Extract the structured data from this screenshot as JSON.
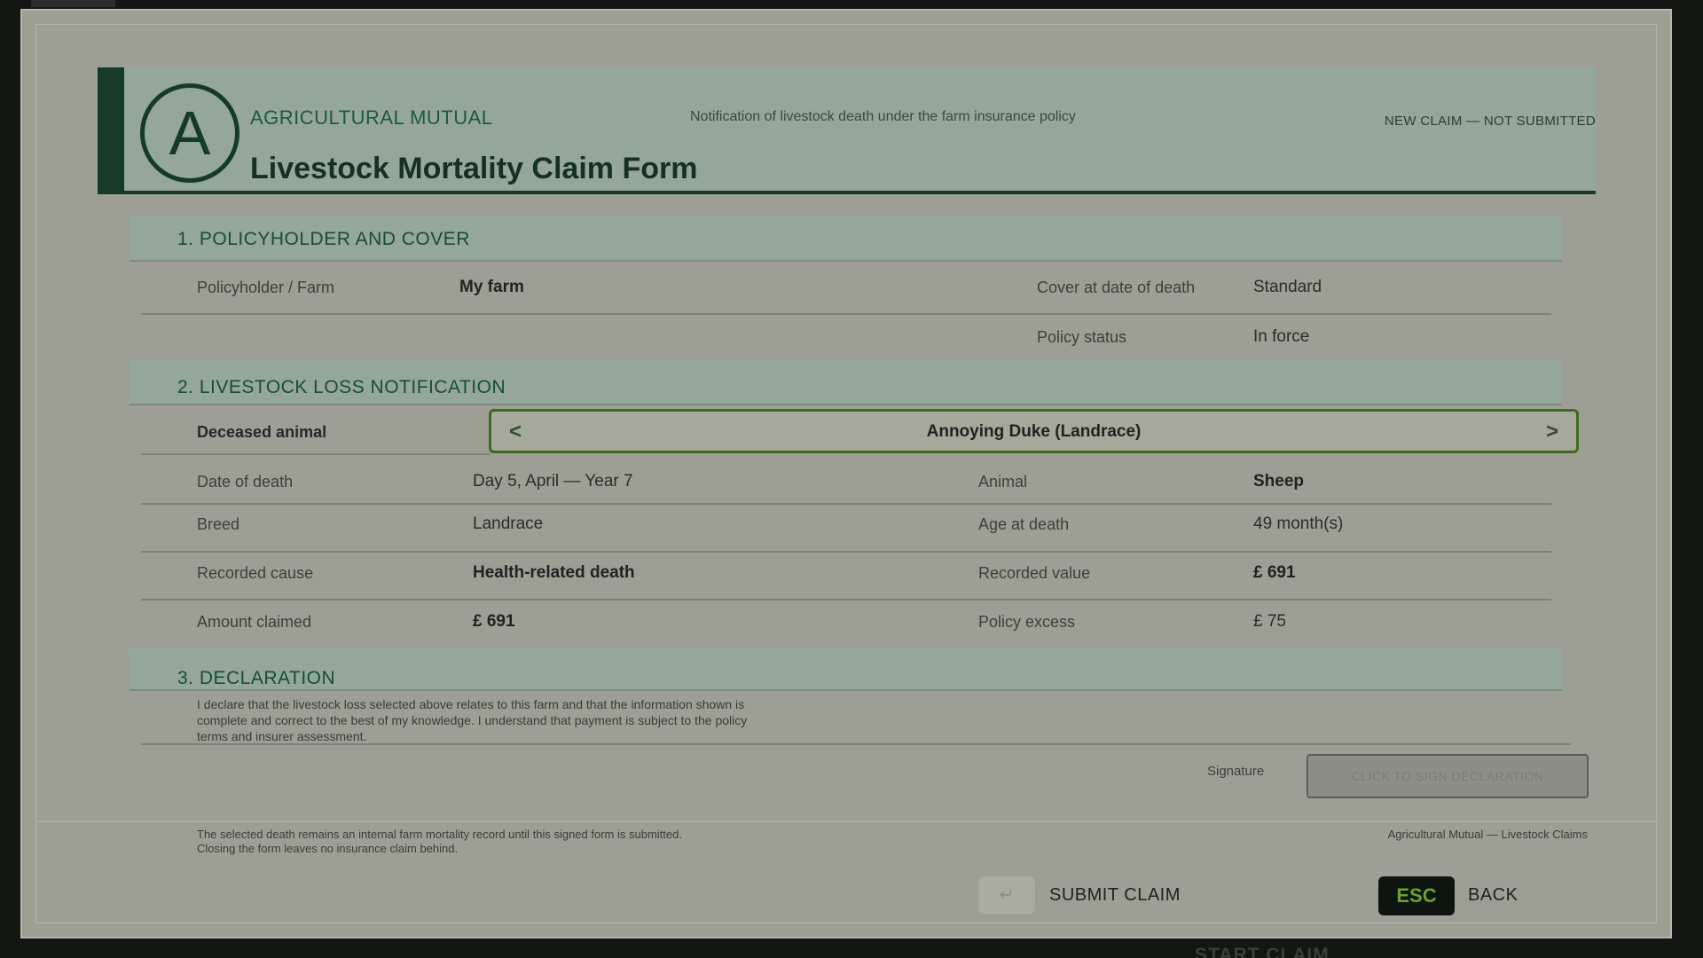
{
  "backdrop": {
    "hint": "START CLAIM"
  },
  "header": {
    "logo_letter": "A",
    "brand": "AGRICULTURAL MUTUAL",
    "title": "Livestock Mortality Claim Form",
    "subtitle": "Notification of livestock death under the farm insurance policy",
    "status": "NEW CLAIM — NOT SUBMITTED"
  },
  "section1": {
    "title": "1. POLICYHOLDER AND COVER",
    "policyholder_label": "Policyholder / Farm",
    "policyholder_value": "My farm",
    "cover_label": "Cover at date of death",
    "cover_value": "Standard",
    "status_label": "Policy status",
    "status_value": "In force"
  },
  "section2": {
    "title": "2. LIVESTOCK LOSS NOTIFICATION",
    "deceased_label": "Deceased animal",
    "selector": {
      "prev": "<",
      "value": "Annoying Duke (Landrace)",
      "next": ">"
    },
    "date_label": "Date of death",
    "date_value": "Day 5, April — Year 7",
    "animal_label": "Animal",
    "animal_value": "Sheep",
    "breed_label": "Breed",
    "breed_value": "Landrace",
    "age_label": "Age at death",
    "age_value": "49 month(s)",
    "cause_label": "Recorded cause",
    "cause_value": "Health-related death",
    "recorded_value_label": "Recorded value",
    "recorded_value": "£ 691",
    "claimed_label": "Amount claimed",
    "claimed_value": "£ 691",
    "excess_label": "Policy excess",
    "excess_value": "£ 75"
  },
  "section3": {
    "title": "3. DECLARATION",
    "text": "I declare that the livestock loss selected above relates to this farm and that the information shown is complete and correct to the best of my knowledge. I understand that payment is subject to the policy terms and insurer assessment.",
    "signature_label": "Signature",
    "sign_button": "CLICK TO SIGN DECLARATION"
  },
  "footer": {
    "note": "The selected death remains an internal farm mortality record until this signed form is submitted. Closing the form leaves no insurance claim behind.",
    "brand": "Agricultural Mutual — Livestock Claims"
  },
  "actions": {
    "submit_key": "↵",
    "submit_label": "SUBMIT CLAIM",
    "esc_key": "ESC",
    "back_label": "BACK"
  },
  "colors": {
    "header_bg": "#95a69a",
    "brand_green": "#163a28",
    "selector_border": "#3e6a20",
    "esc_accent": "#6fa12c"
  }
}
